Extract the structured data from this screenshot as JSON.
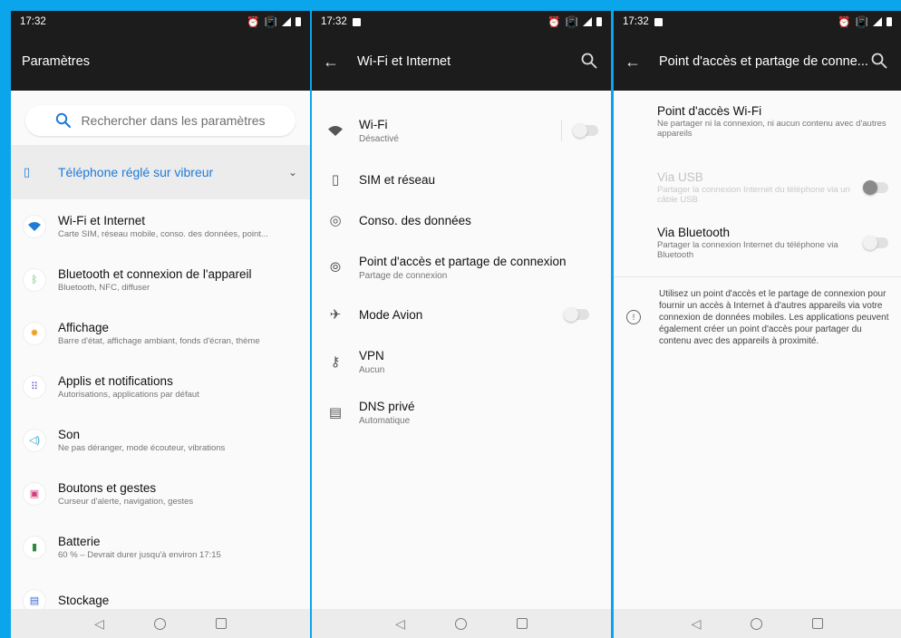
{
  "colors": {
    "background": "#0aa5ea",
    "accent": "#1f7ad8",
    "appbar": "#1c1c1c"
  },
  "screen1": {
    "status_time": "17:32",
    "title": "Paramètres",
    "search_placeholder": "Rechercher dans les paramètres",
    "vibrate_banner": "Téléphone réglé sur vibreur",
    "items": [
      {
        "title": "Wi-Fi et Internet",
        "subtitle": "Carte SIM, réseau mobile, conso. des données, point...",
        "icon": "wifi-icon",
        "color": "#1f7ad8"
      },
      {
        "title": "Bluetooth et connexion de l'appareil",
        "subtitle": "Bluetooth, NFC, diffuser",
        "icon": "bluetooth-icon",
        "color": "#4caf50"
      },
      {
        "title": "Affichage",
        "subtitle": "Barre d'état, affichage ambiant, fonds d'écran, thème",
        "icon": "brightness-icon",
        "color": "#f0a020"
      },
      {
        "title": "Applis et notifications",
        "subtitle": "Autorisations, applications par défaut",
        "icon": "apps-grid-icon",
        "color": "#7b4fd8"
      },
      {
        "title": "Son",
        "subtitle": "Ne pas déranger, mode écouteur, vibrations",
        "icon": "volume-icon",
        "color": "#2aa0c8"
      },
      {
        "title": "Boutons et gestes",
        "subtitle": "Curseur d'alerte, navigation, gestes",
        "icon": "buttons-icon",
        "color": "#d0407a"
      },
      {
        "title": "Batterie",
        "subtitle": "60 % – Devrait durer jusqu'à environ 17:15",
        "icon": "battery-icon",
        "color": "#2e8b3e"
      },
      {
        "title": "Stockage",
        "subtitle": "",
        "icon": "storage-icon",
        "color": "#3a6ad8"
      }
    ]
  },
  "screen2": {
    "status_time": "17:32",
    "title": "Wi-Fi et Internet",
    "items": [
      {
        "title": "Wi-Fi",
        "subtitle": "Désactivé",
        "icon": "wifi-icon"
      },
      {
        "title": "SIM et réseau",
        "subtitle": "",
        "icon": "sim-card-icon"
      },
      {
        "title": "Conso. des données",
        "subtitle": "",
        "icon": "data-usage-icon"
      },
      {
        "title": "Point d'accès et partage de connexion",
        "subtitle": "Partage de connexion",
        "icon": "hotspot-icon"
      },
      {
        "title": "Mode Avion",
        "subtitle": "",
        "icon": "airplane-icon"
      },
      {
        "title": "VPN",
        "subtitle": "Aucun",
        "icon": "vpn-key-icon"
      },
      {
        "title": "DNS privé",
        "subtitle": "Automatique",
        "icon": "dns-icon"
      }
    ]
  },
  "screen3": {
    "status_time": "17:32",
    "title": "Point d'accès et partage de conne...",
    "items": [
      {
        "title": "Point d'accès Wi-Fi",
        "subtitle": "Ne partager ni la connexion, ni aucun contenu avec d'autres appareils"
      },
      {
        "title": "Via USB",
        "subtitle": "Partager la connexion Internet du téléphone via un câble USB"
      },
      {
        "title": "Via Bluetooth",
        "subtitle": "Partager la connexion Internet du téléphone via Bluetooth"
      }
    ],
    "info": "Utilisez un point d'accès et le partage de connexion pour fournir un accès à Internet à d'autres appareils via votre connexion de données mobiles. Les applications peuvent également créer un point d'accès pour partager du contenu avec des appareils à proximité."
  }
}
